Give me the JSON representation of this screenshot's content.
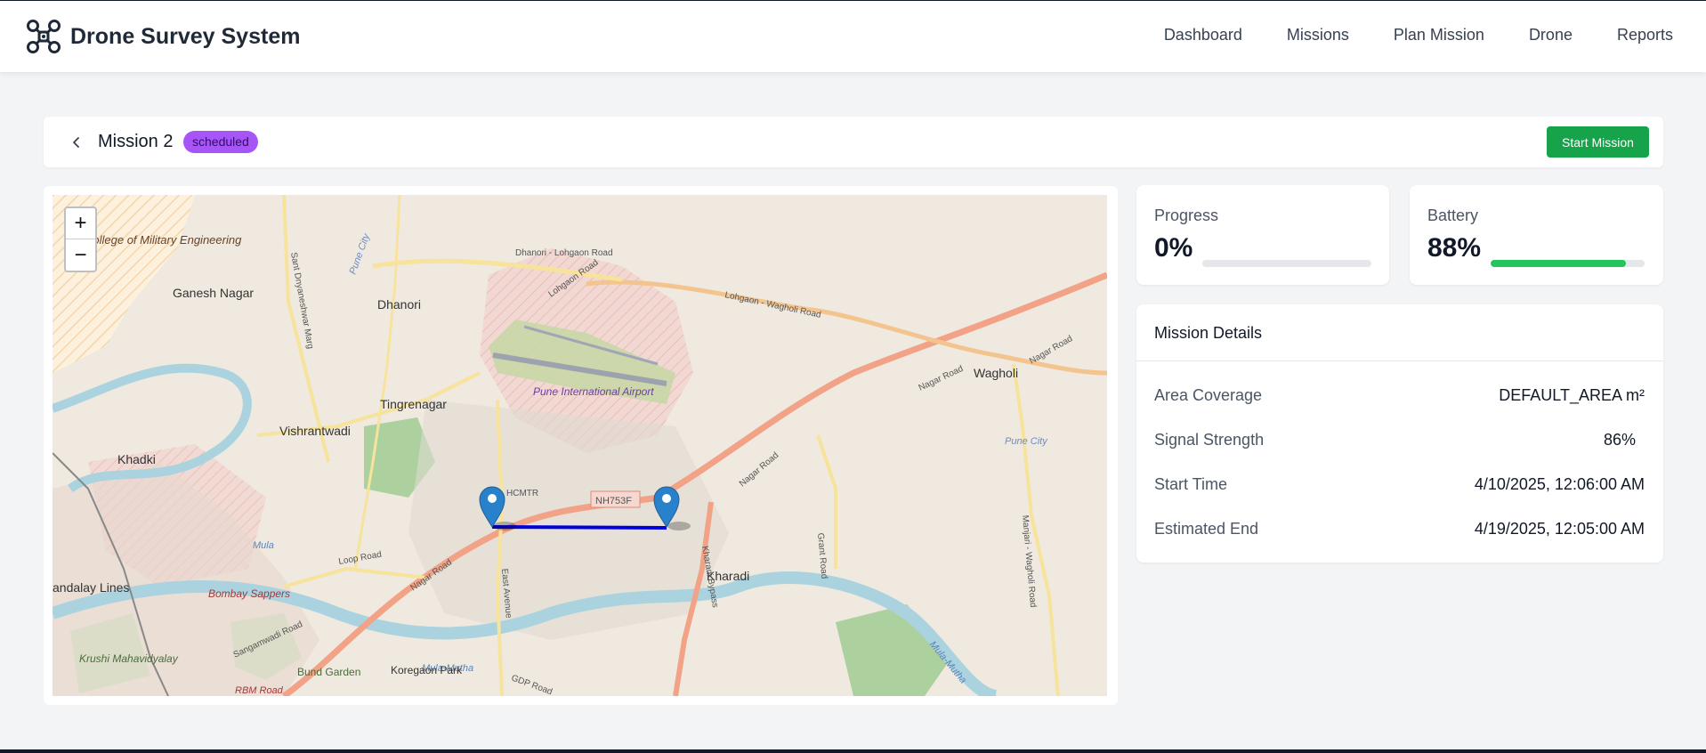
{
  "app": {
    "title": "Drone Survey System",
    "nav": [
      "Dashboard",
      "Missions",
      "Plan Mission",
      "Drone",
      "Reports"
    ]
  },
  "mission": {
    "title": "Mission 2",
    "status": "scheduled",
    "start_label": "Start Mission"
  },
  "map": {
    "zoom_in": "+",
    "zoom_out": "−",
    "labels": {
      "college": "College of Military Engineering",
      "ganesh_nagar": "Ganesh Nagar",
      "dhanori": "Dhanori",
      "dhanori_lohgaon_road": "Dhanori - Lohgaon Road",
      "lohgaon_wagholi_road": "Lohgaon - Wagholi Road",
      "airport": "Pune International Airport",
      "tingrenagar": "Tingrenagar",
      "vishrantwadi": "Vishrantwadi",
      "khadki": "Khadki",
      "wagholi": "Wagholi",
      "pune_city_1": "Pune City",
      "pune_city_2": "Pune City",
      "nagar_road_1": "Nagar Road",
      "nagar_road_2": "Nagar Road",
      "nagar_road_3": "Nagar Road",
      "nagar_road_4": "Nagar Road",
      "nh753f": "NH753F",
      "hcmtr": "HCMTR",
      "kharadi": "Kharadi",
      "kharadi_bypass": "Kharadi Bypass",
      "loop_road": "Loop Road",
      "bombay_sappers": "Bombay Sappers",
      "bandalay_lines": "andalay Lines",
      "mula": "Mula",
      "mula_mutha_1": "Mula-Mutha",
      "mula_mutha_2": "Mula-Mutha",
      "sangamwadi_road": "Sangamwadi Road",
      "krushi_mahavidyalay": "Krushi Mahavidyalay",
      "rbm_road": "RBM Road",
      "bund_garden": "Bund Garden",
      "koregaon_park": "Koregaon Park",
      "gdp_road": "GDP Road",
      "east_avenue": "East Avenue",
      "grant_road": "Grant Road",
      "manjari_wagholi_road": "Manjari - Wagholi Road",
      "lohgaon_road": "Lohgaon Road",
      "sant_dnyaneshwar_marg": "Sant Dnyaneshwar Marg"
    },
    "colors": {
      "route": "#0000dd",
      "marker": "#2a81cb"
    }
  },
  "stats": {
    "progress": {
      "label": "Progress",
      "value": "0%",
      "fraction": 0.0
    },
    "battery": {
      "label": "Battery",
      "value": "88%",
      "fraction": 0.88
    }
  },
  "details": {
    "title": "Mission Details",
    "rows": [
      {
        "label": "Area Coverage",
        "value": "DEFAULT_AREA m²"
      },
      {
        "label": "Signal Strength",
        "value": "86%"
      },
      {
        "label": "Start Time",
        "value": "4/10/2025, 12:06:00 AM"
      },
      {
        "label": "Estimated End",
        "value": "4/19/2025, 12:05:00 AM"
      }
    ]
  }
}
